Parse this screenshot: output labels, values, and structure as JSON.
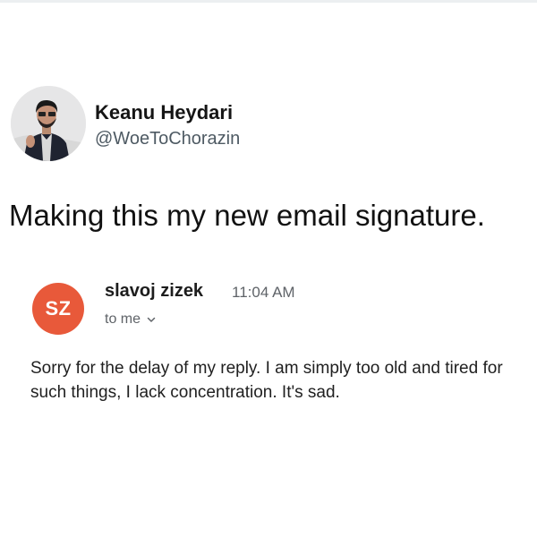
{
  "tweet": {
    "author_name": "Keanu Heydari",
    "author_handle": "@WoeToChorazin",
    "text": "Making this my new email signature."
  },
  "email": {
    "sender_initials": "SZ",
    "sender_name": "slavoj zizek",
    "time": "11:04 AM",
    "recipient_label": "to me",
    "body": "Sorry for the delay of my reply. I am simply too old and tired for such things, I lack concentration. It's sad."
  },
  "colors": {
    "sender_avatar_bg": "#e8593a",
    "handle_gray": "#4e5a63",
    "meta_gray": "#5f6368"
  },
  "icons": {
    "recipient_expand": "chevron-down-icon",
    "profile_photo": "profile-photo"
  }
}
